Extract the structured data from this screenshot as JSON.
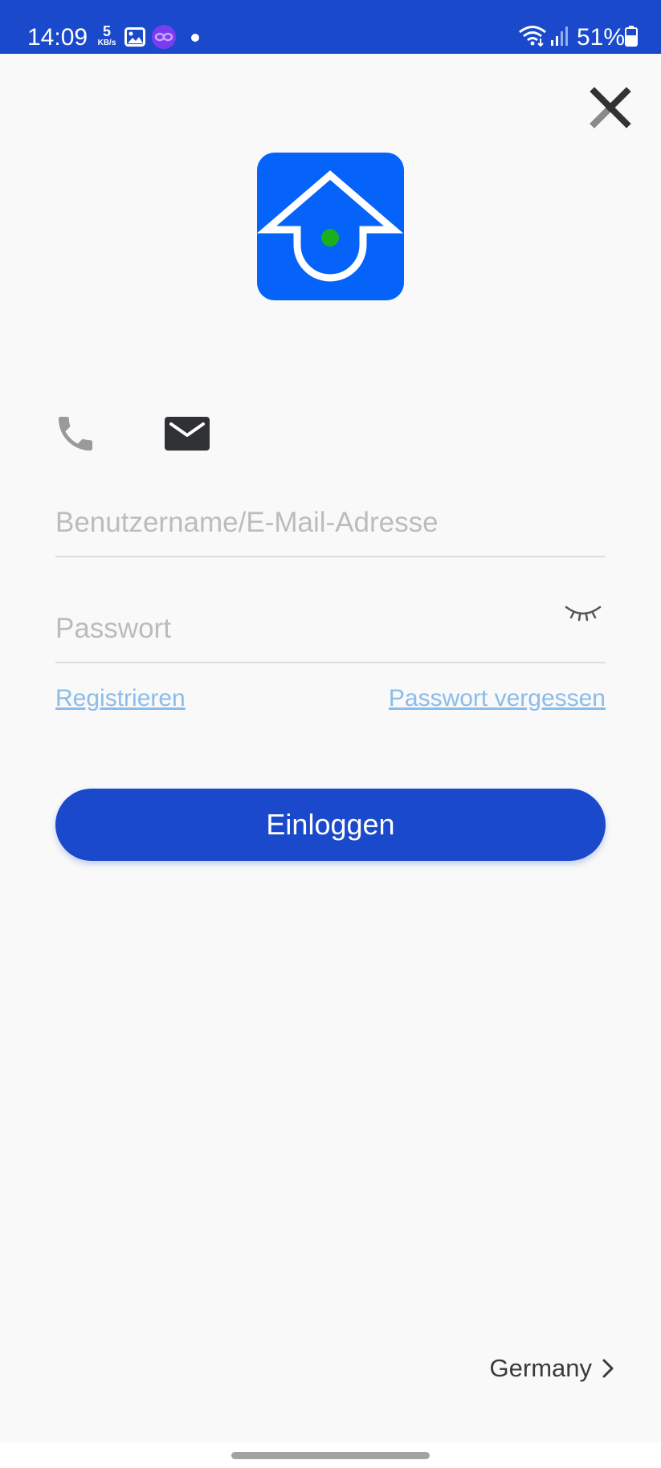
{
  "status_bar": {
    "time": "14:09",
    "speed_value": "5",
    "speed_unit": "KB/s",
    "battery": "51%",
    "background": "#1a4acb"
  },
  "icons": {
    "close": "close-icon",
    "phone": "phone-icon",
    "email": "envelope-icon",
    "eye": "eye-closed-icon",
    "chevron": "chevron-right-icon",
    "logo": "home-arrow-logo"
  },
  "form": {
    "username_placeholder": "Benutzername/E-Mail-Adresse",
    "username_value": "",
    "password_placeholder": "Passwort",
    "password_value": ""
  },
  "links": {
    "register": "Registrieren",
    "forgot_password": "Passwort vergessen"
  },
  "login_button": {
    "label": "Einloggen"
  },
  "region": {
    "label": "Germany"
  },
  "colors": {
    "primary": "#1a4acb",
    "logo_background": "#0563f9",
    "logo_dot": "#1ab01a",
    "link": "#8cbcea",
    "placeholder": "#bcbcbc",
    "divider": "#dedede"
  }
}
